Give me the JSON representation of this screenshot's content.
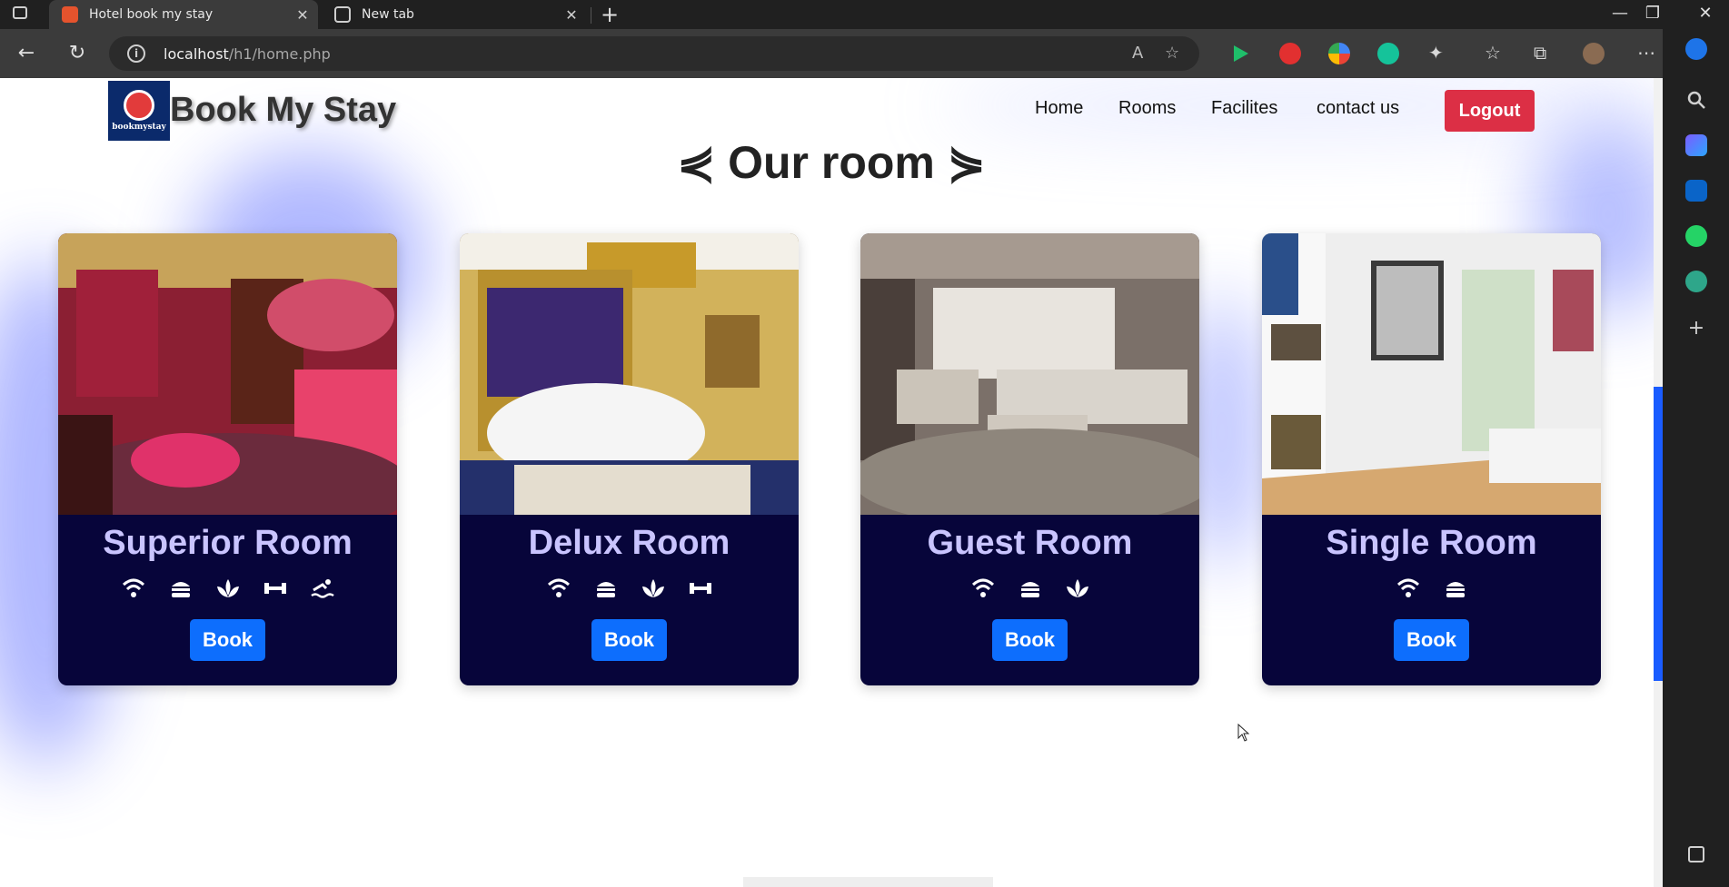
{
  "browser": {
    "tabs": [
      {
        "title": "Hotel book my stay",
        "active": true
      },
      {
        "title": "New tab",
        "active": false
      }
    ],
    "url_host": "localhost",
    "url_path": "/h1/home.php"
  },
  "site": {
    "logo_text": "bookmystay",
    "brand": "Book My Stay",
    "nav": [
      "Home",
      "Rooms",
      "Facilites",
      "contact us"
    ],
    "logout_label": "Logout"
  },
  "section": {
    "title": "⋞ Our room ⋟"
  },
  "rooms": [
    {
      "name": "Superior Room",
      "book_label": "Book",
      "facilities": [
        "wifi-icon",
        "burger-icon",
        "spa-icon",
        "gym-icon",
        "swimming-icon"
      ]
    },
    {
      "name": "Delux Room",
      "book_label": "Book",
      "facilities": [
        "wifi-icon",
        "burger-icon",
        "spa-icon",
        "gym-icon"
      ]
    },
    {
      "name": "Guest Room",
      "book_label": "Book",
      "facilities": [
        "wifi-icon",
        "burger-icon",
        "spa-icon"
      ]
    },
    {
      "name": "Single Room",
      "book_label": "Book",
      "facilities": [
        "wifi-icon",
        "burger-icon"
      ]
    }
  ],
  "colors": {
    "card_bg": "#07053a",
    "room_name": "#c9c4ff",
    "book_button": "#0d6efd",
    "logout_button": "#dc2f45"
  }
}
